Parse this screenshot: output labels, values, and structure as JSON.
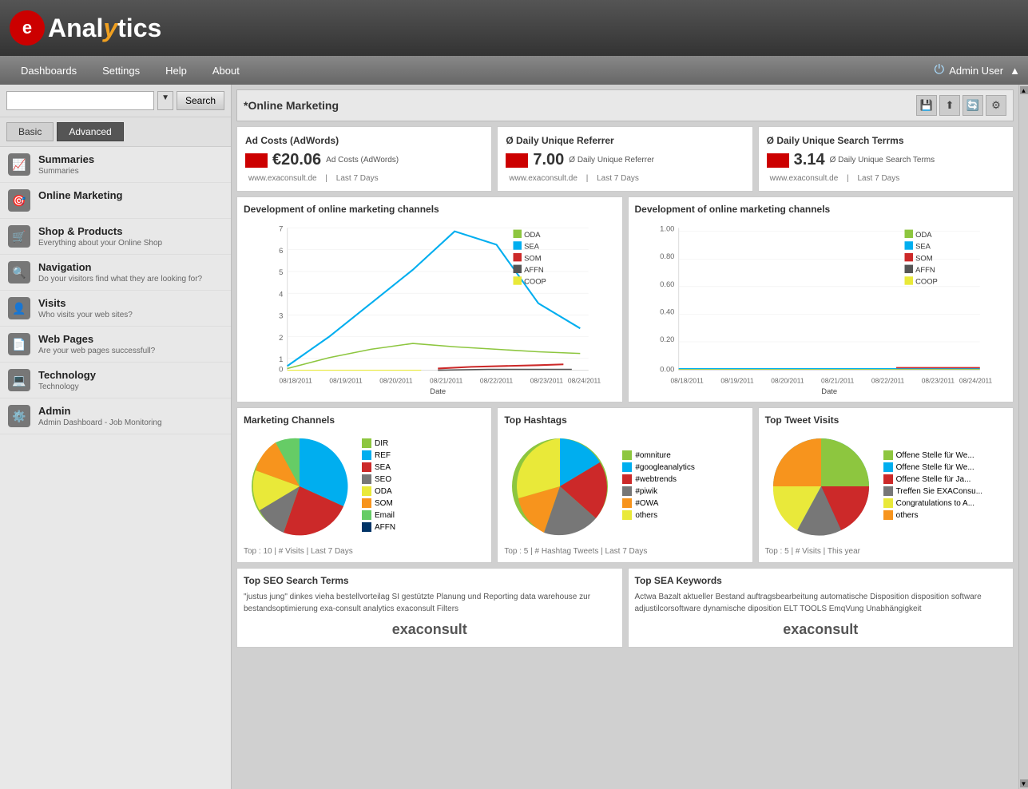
{
  "header": {
    "logo_letter": "e",
    "logo_name": "Analytics",
    "admin_label": "Admin User"
  },
  "navbar": {
    "items": [
      {
        "label": "Dashboards"
      },
      {
        "label": "Settings"
      },
      {
        "label": "Help"
      },
      {
        "label": "About"
      }
    ]
  },
  "sidebar": {
    "search_placeholder": "",
    "search_label": "Search",
    "tab_basic": "Basic",
    "tab_advanced": "Advanced",
    "items": [
      {
        "icon": "📈",
        "label": "Summaries",
        "sub": "Summaries"
      },
      {
        "icon": "🎯",
        "label": "Online Marketing",
        "sub": ""
      },
      {
        "icon": "🛒",
        "label": "Shop & Products",
        "sub": "Everything about your Online Shop"
      },
      {
        "icon": "🔍",
        "label": "Navigation",
        "sub": "Do your visitors find what they are looking for?"
      },
      {
        "icon": "👤",
        "label": "Visits",
        "sub": "Who visits your web sites?"
      },
      {
        "icon": "📄",
        "label": "Web Pages",
        "sub": "Are your web pages successfull?"
      },
      {
        "icon": "💻",
        "label": "Technology",
        "sub": "Technology"
      },
      {
        "icon": "⚙️",
        "label": "Admin",
        "sub": "Admin Dashboard - Job Monitoring"
      }
    ]
  },
  "page_title": "*Online Marketing",
  "metrics": [
    {
      "title": "Ad Costs (AdWords)",
      "value": "€20.06",
      "label": "Ad Costs (AdWords)",
      "site": "www.exaconsult.de",
      "period": "Last 7 Days"
    },
    {
      "title": "Ø Daily Unique Referrer",
      "value": "7.00",
      "label": "Ø Daily Unique Referrer",
      "site": "www.exaconsult.de",
      "period": "Last 7 Days"
    },
    {
      "title": "Ø Daily Unique Search Terrms",
      "value": "3.14",
      "label": "Ø Daily Unique Search Terms",
      "site": "www.exaconsult.de",
      "period": "Last 7 Days"
    }
  ],
  "charts": {
    "title": "Development of online marketing channels",
    "legend": [
      "ODA",
      "SEA",
      "SOM",
      "AFFN",
      "COOP"
    ],
    "legend_colors": [
      "#8dc63f",
      "#00aeef",
      "#cc2929",
      "#555555",
      "#e9e939"
    ],
    "x_labels": [
      "08/18/2011",
      "08/19/2011",
      "08/20/2011",
      "08/21/2011",
      "08/22/2011",
      "08/23/2011",
      "08/24/2011"
    ],
    "x_label_bottom": "Date"
  },
  "marketing_channels": {
    "title": "Marketing Channels",
    "legend": [
      "DIR",
      "REF",
      "SEA",
      "SEO",
      "ODA",
      "SOM",
      "Email",
      "AFFN"
    ],
    "legend_colors": [
      "#8dc63f",
      "#00aeef",
      "#cc2929",
      "#777777",
      "#e9e939",
      "#f7941d",
      "#66cc66",
      "#003366"
    ],
    "footer": "Top : 10  |  # Visits  |  Last 7 Days"
  },
  "top_hashtags": {
    "title": "Top Hashtags",
    "legend": [
      "#omniture",
      "#googleanalytics",
      "#webtrends",
      "#piwik",
      "#OWA",
      "others"
    ],
    "legend_colors": [
      "#8dc63f",
      "#00aeef",
      "#cc2929",
      "#777777",
      "#f7941d",
      "#e9e939"
    ],
    "footer": "Top : 5  |  # Hashtag Tweets  |  Last 7 Days"
  },
  "top_tweet_visits": {
    "title": "Top Tweet Visits",
    "legend": [
      "Offene Stelle für We...",
      "Offene Stelle für We...",
      "Offene Stelle für Ja...",
      "Treffen Sie EXAConsu...",
      "Congratulations to A...",
      "others"
    ],
    "legend_colors": [
      "#8dc63f",
      "#00aeef",
      "#cc2929",
      "#777777",
      "#e9e93a",
      "#f7941d"
    ],
    "footer": "Top : 5  |  # Visits  |  This year"
  },
  "seo": {
    "title": "Top SEO Search Terms",
    "content": "\"justus jung\" dinkes vieha bestellvorteilag SI gestützte Planung und Reporting\ndata warehouse zur bestandsoptimierung exa-consult analytics exaconsult Filters",
    "logo": "exaconsult"
  },
  "sea": {
    "title": "Top SEA Keywords",
    "content": "Actwa Bazalt aktueller Bestand auftragsbearbeitung automatische Disposition disposition software\nadjustilcorsoftware dynamische diposition ELT TOOLS EmqVung Unabhängigkeit",
    "logo": "exaconsult"
  }
}
